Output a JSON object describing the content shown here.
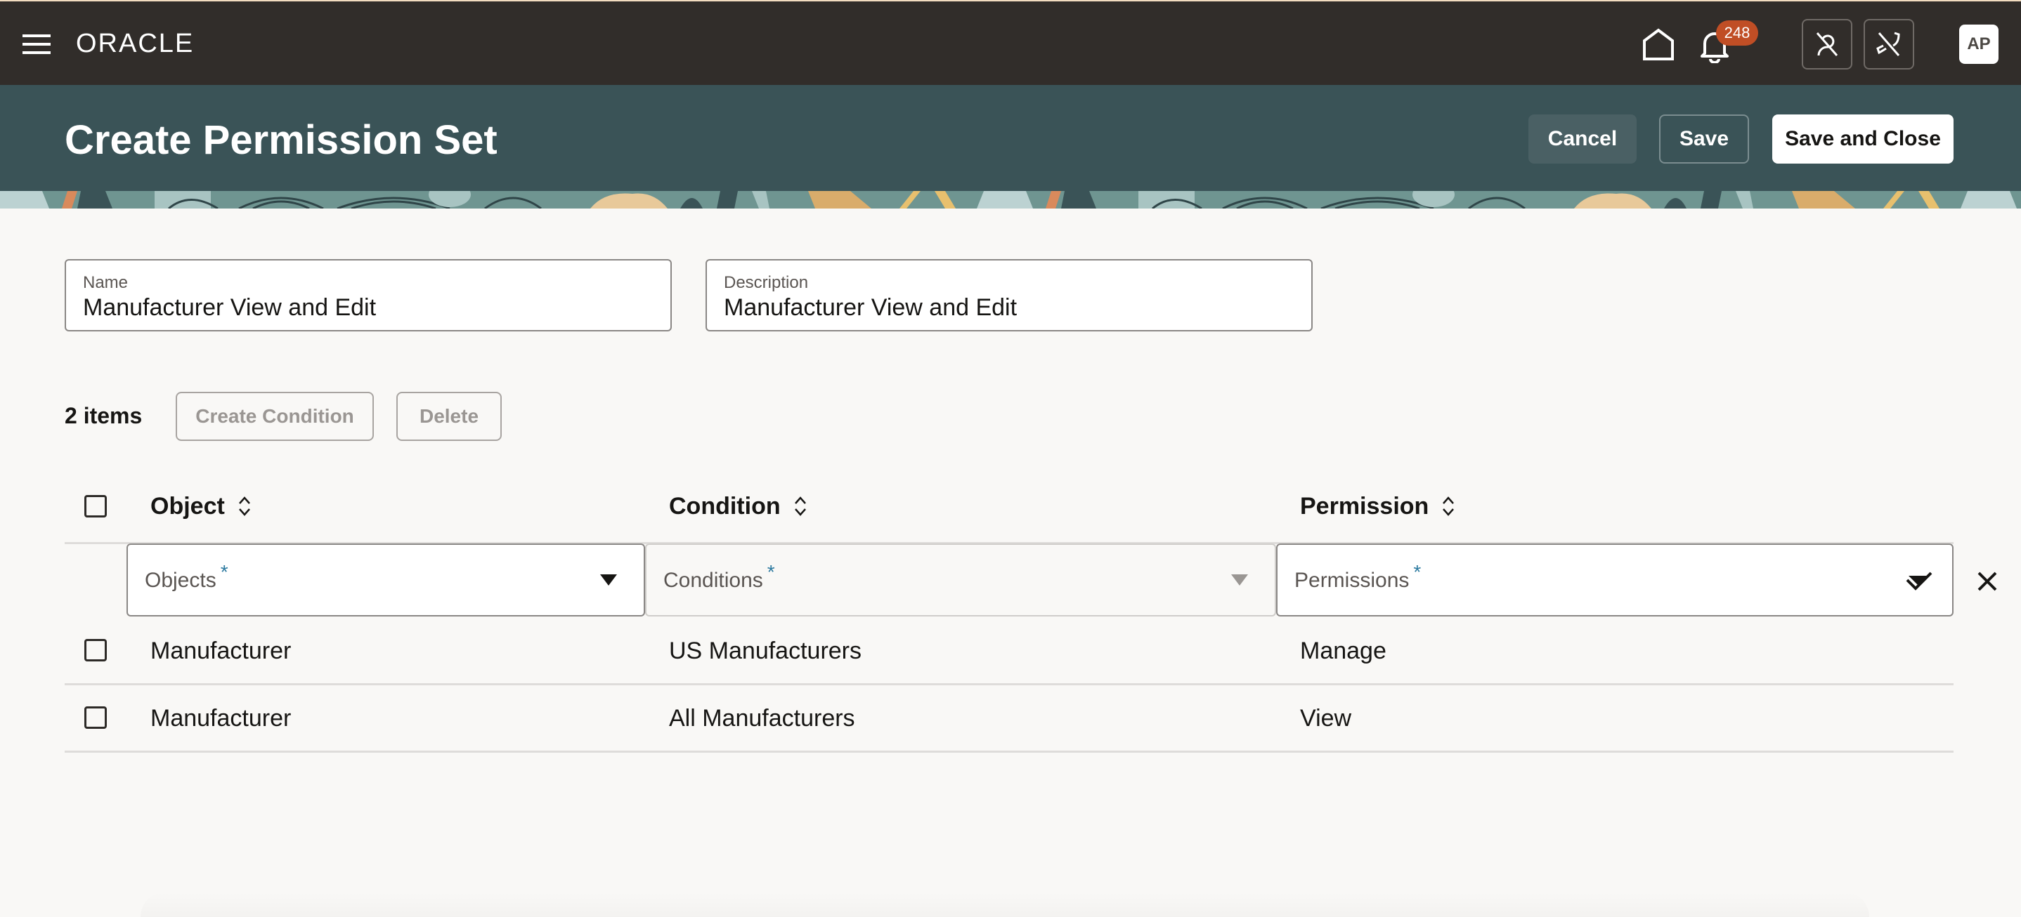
{
  "topbar": {
    "brand": "ORACLE",
    "notification_count": "248",
    "avatar_initials": "AP",
    "icons": [
      "hamburger-menu-icon",
      "home-icon",
      "bell-icon",
      "presence-unavailable-icon",
      "phone-off-icon"
    ]
  },
  "header": {
    "title": "Create Permission Set",
    "cancel_label": "Cancel",
    "save_label": "Save",
    "save_close_label": "Save and Close"
  },
  "form": {
    "name": {
      "label": "Name",
      "value": "Manufacturer View and Edit"
    },
    "description": {
      "label": "Description",
      "value": "Manufacturer View and Edit"
    }
  },
  "toolbar": {
    "item_count": "2 items",
    "create_condition_label": "Create Condition",
    "delete_label": "Delete"
  },
  "table": {
    "columns": [
      "Object",
      "Condition",
      "Permission"
    ],
    "new_row": {
      "objects_placeholder": "Objects",
      "conditions_placeholder": "Conditions",
      "permissions_placeholder": "Permissions",
      "required_marker": "*"
    },
    "rows": [
      {
        "object": "Manufacturer",
        "condition": "US Manufacturers",
        "permission": "Manage"
      },
      {
        "object": "Manufacturer",
        "condition": "All Manufacturers",
        "permission": "View"
      }
    ]
  },
  "colors": {
    "topbar_bg": "#312d2a",
    "header_bg": "#3a5357",
    "badge": "#c04e25",
    "required": "#2d7aa0"
  }
}
